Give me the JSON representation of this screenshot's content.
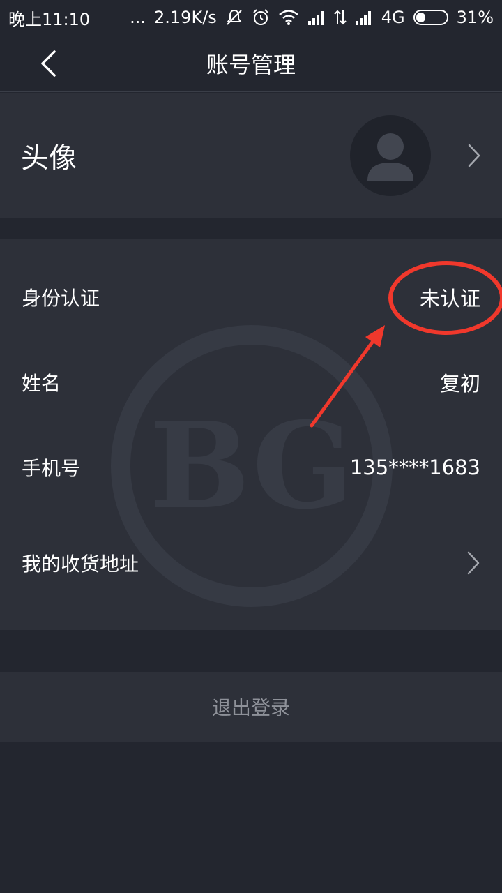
{
  "status_bar": {
    "time": "晚上11:10",
    "dots": "...",
    "net_speed": "2.19K/s",
    "network": "4G",
    "battery": "31%",
    "battery_level": 0.31
  },
  "nav": {
    "title": "账号管理"
  },
  "avatar_section": {
    "label": "头像"
  },
  "info": {
    "rows": [
      {
        "label": "身份认证",
        "value": "未认证"
      },
      {
        "label": "姓名",
        "value": "复初"
      },
      {
        "label": "手机号",
        "value": "135****1683"
      },
      {
        "label": "我的收货地址",
        "value": ""
      }
    ],
    "watermark": "BG"
  },
  "logout": {
    "label": "退出登录"
  },
  "colors": {
    "background": "#23262f",
    "panel": "#2d3039",
    "annotation": "#f0382c",
    "muted_text": "#8e9199"
  }
}
